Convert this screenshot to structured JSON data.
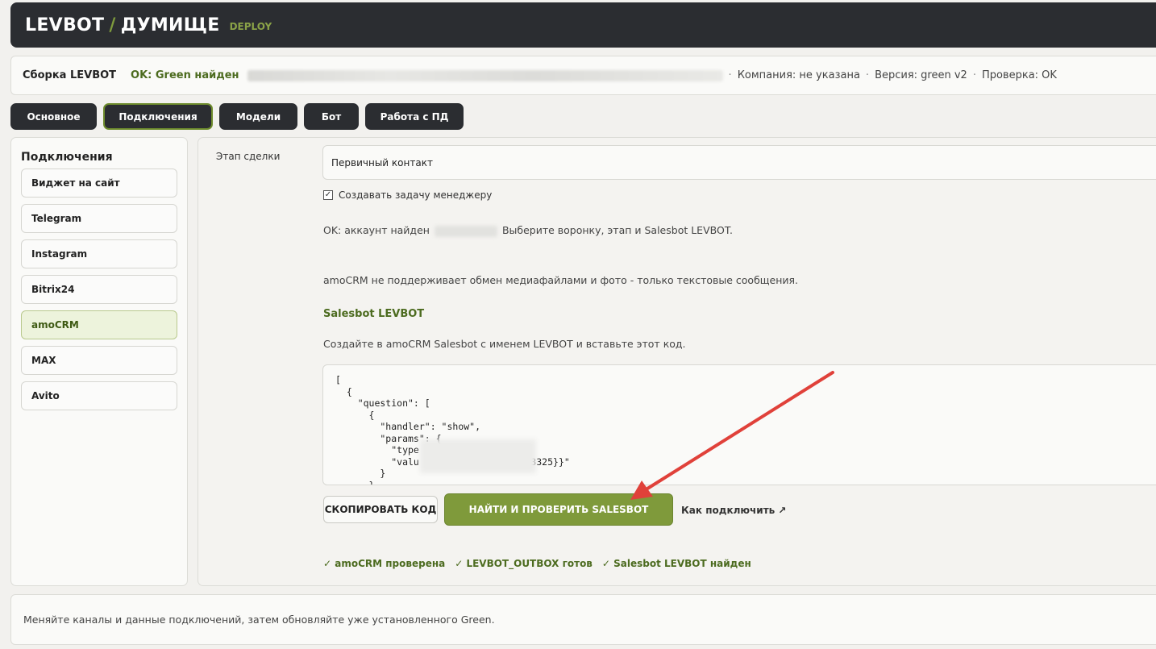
{
  "header": {
    "brand_left": "LEVBOT",
    "slash": "/",
    "brand_right": "ДУМИЩЕ",
    "env": "DEPLOY"
  },
  "infobar": {
    "build_label": "Сборка LEVBOT",
    "status": "OK: Green найден",
    "company": "Компания: не указана",
    "version": "Версия: green v2",
    "check": "Проверка: OK",
    "separator": "·"
  },
  "tabs": [
    {
      "label": "Основное",
      "active": false
    },
    {
      "label": "Подключения",
      "active": true
    },
    {
      "label": "Модели",
      "active": false
    },
    {
      "label": "Бот",
      "active": false
    },
    {
      "label": "Работа с ПД",
      "active": false
    }
  ],
  "sidebar": {
    "title": "Подключения",
    "items": [
      {
        "label": "Виджет на сайт",
        "active": false
      },
      {
        "label": "Telegram",
        "active": false
      },
      {
        "label": "Instagram",
        "active": false
      },
      {
        "label": "Bitrix24",
        "active": false
      },
      {
        "label": "amoCRM",
        "active": true
      },
      {
        "label": "MAX",
        "active": false
      },
      {
        "label": "Avito",
        "active": false
      }
    ]
  },
  "main": {
    "stage_label": "Этап сделки",
    "stage_value": "Первичный контакт",
    "create_task_label": "Создавать задачу менеджеру",
    "create_task_checked": true,
    "account_ok_prefix": "OK: аккаунт найден",
    "account_ok_suffix": "Выберите воронку, этап и Salesbot LEVBOT.",
    "media_note": "amoCRM не поддерживает обмен медиафайлами и фото - только текстовые сообщения.",
    "salesbot_title": "Salesbot LEVBOT",
    "salesbot_instruction": "Создайте в amoCRM Salesbot с именем LEVBOT и вставьте этот код.",
    "code": "[\n  {\n    \"question\": [\n      {\n        \"handler\": \"show\",\n        \"params\": {\n          \"type\n          \"valu                    3325}}\"\n        }\n      }",
    "copy_button": "СКОПИРОВАТЬ КОД",
    "find_button": "НАЙТИ И ПРОВЕРИТЬ SALESBOT",
    "how_link": "Как подключить ↗",
    "statuses": [
      "✓ amoCRM проверена",
      "✓ LEVBOT_OUTBOX готов",
      "✓ Salesbot LEVBOT найден"
    ]
  },
  "footer": {
    "text": "Меняйте каналы и данные подключений, затем обновляйте уже установленного Green."
  },
  "colors": {
    "accent_green": "#7f9a3b",
    "dark": "#2b2d31",
    "arrow_red": "#e0413a"
  }
}
